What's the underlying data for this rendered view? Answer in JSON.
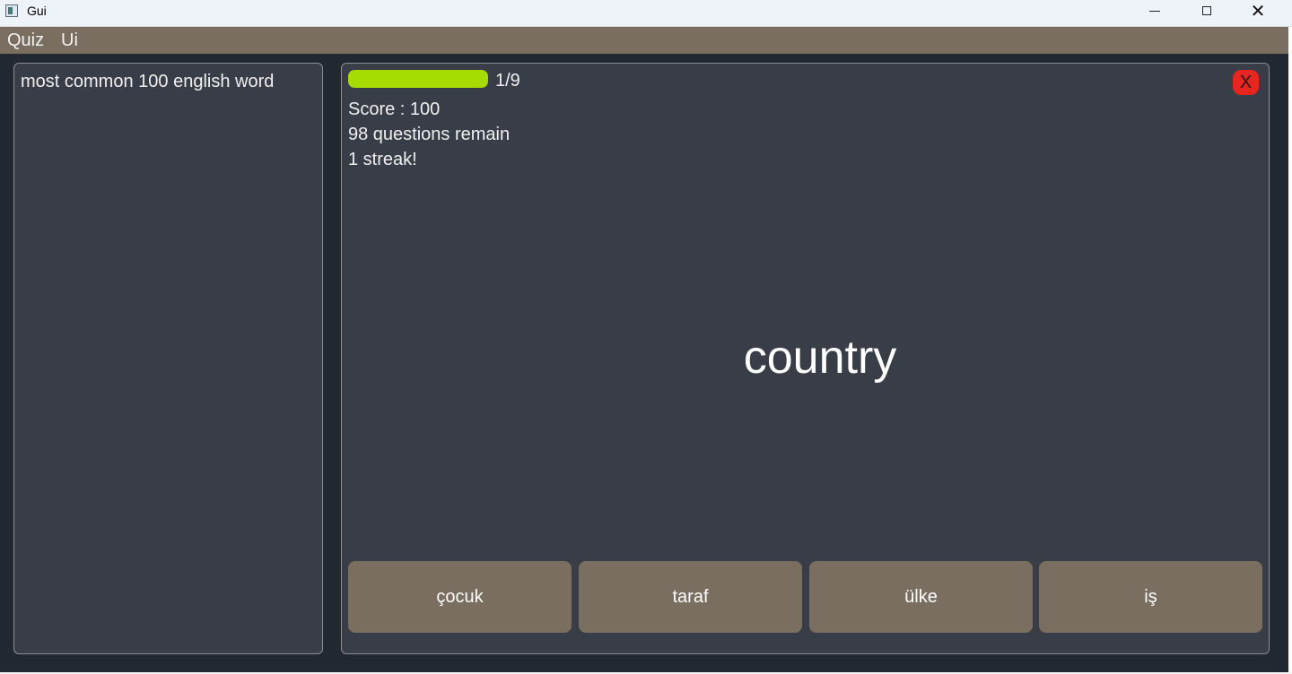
{
  "window": {
    "title": "Gui",
    "minimize_icon": "minimize-icon",
    "maximize_icon": "maximize-icon",
    "close_label": "✕"
  },
  "menubar": {
    "items": [
      {
        "label": "Quiz"
      },
      {
        "label": "Ui"
      }
    ]
  },
  "sidebar": {
    "items": [
      {
        "label": "most common 100 english word"
      }
    ]
  },
  "quiz": {
    "progress": {
      "current": 1,
      "total": 9,
      "fraction": 0.111,
      "label": "1/9",
      "fill_color": "#a6dc00"
    },
    "close_label": "X",
    "close_color": "#e8261f",
    "score_text": "Score : 100",
    "remaining_text": "98 questions remain",
    "streak_text": "1 streak!",
    "question_word": "country",
    "answers": [
      {
        "label": "çocuk"
      },
      {
        "label": "taraf"
      },
      {
        "label": "ülke"
      },
      {
        "label": "iş"
      }
    ]
  },
  "colors": {
    "background": "#212831",
    "panel": "#393d47",
    "accent": "#7a6e60"
  }
}
